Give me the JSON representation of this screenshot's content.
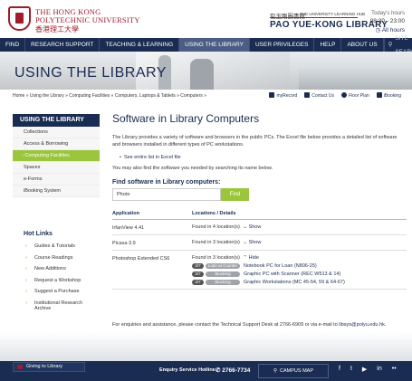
{
  "header": {
    "university_en_line1": "THE HONG KONG",
    "university_en_line2": "POLYTECHNIC UNIVERSITY",
    "university_zh": "香港理工大學",
    "library_zh": "包玉剛圖書館",
    "library_hub": "THE UNIVERSITY LEARNING HUB",
    "library_en": "PAO YUE-KONG LIBRARY",
    "hours_label": "Today's hours",
    "hours_time": "08:30 - 23:00",
    "all_hours": "All hours"
  },
  "nav": {
    "items": [
      {
        "label": "FIND"
      },
      {
        "label": "RESEARCH SUPPORT"
      },
      {
        "label": "TEACHING & LEARNING"
      },
      {
        "label": "USING THE LIBRARY"
      },
      {
        "label": "USER PRIVILEGES"
      },
      {
        "label": "HELP"
      },
      {
        "label": "ABOUT US"
      }
    ],
    "search_placeholder": "SITE SEARCH"
  },
  "banner": {
    "title": "USING THE LIBRARY"
  },
  "breadcrumb": "Home » Using the Library » Computing Facilities » Computers, Laptops & Tablets » Computers »",
  "tools": [
    {
      "label": "myRecord",
      "color": "#1a2c52"
    },
    {
      "label": "Contact Us",
      "color": "#1a2c52"
    },
    {
      "label": "Floor Plan",
      "color": "#1a2c52"
    },
    {
      "label": "iBooking",
      "color": "#1a2c52"
    }
  ],
  "sidebar": {
    "heading": "USING THE LIBRARY",
    "items": [
      {
        "label": "Collections"
      },
      {
        "label": "Access & Borrowing"
      },
      {
        "label": "Computing Facilities"
      },
      {
        "label": "Spaces"
      },
      {
        "label": "e-Forms"
      },
      {
        "label": "iBooking System"
      }
    ],
    "hot_links_title": "Hot Links",
    "hot_links": [
      {
        "label": "Guides & Tutorials"
      },
      {
        "label": "Course Readings"
      },
      {
        "label": "New Additions"
      },
      {
        "label": "Request a Workshop"
      },
      {
        "label": "Suggest a Purchase"
      },
      {
        "label": "Institutional Research Archive"
      }
    ]
  },
  "main": {
    "title": "Software in Library Computers",
    "intro": "The Library provides a variety of software and browsers in the public PCs. The Excel file below provides a detailed list of software and browsers installed in different types of PC workstations.",
    "excel_link": "See entire list in Excel file",
    "tip": "You may also find the software you needed by searching its name below.",
    "find_title": "Find software in Library computers:",
    "search_value": "Photo",
    "find_button": "Find",
    "table_headers": {
      "app": "Application",
      "loc": "Locations / Details"
    },
    "rows": [
      {
        "app": "IrfanView 4.41",
        "found": "Found in 4 location(s)",
        "toggle": "Show"
      },
      {
        "app": "Picasa 3.9",
        "found": "Found in 3 location(s)",
        "toggle": "Show"
      },
      {
        "app": "Photoshop Extended CS6",
        "found": "Found in 3 location(s)",
        "toggle": "Hide"
      }
    ],
    "locations": [
      {
        "count": "3/7",
        "type": "Loan at Counter",
        "name": "Notebook PC for Loan (N806-25)"
      },
      {
        "count": "3/7",
        "type": "iBooking",
        "name": "Graphic PC with Scanner (REC W513 & 14)"
      },
      {
        "count": "3/7",
        "type": "iBooking",
        "name": "Graphic Workstations (MC 45-54, 59 & 64-67)"
      }
    ],
    "enquiry_text": "For enquiries and assistance, please contact the Technical Support Desk at 2766-6909 or via e-mail to",
    "enquiry_email": "libsys@polyu.edu.hk",
    "enquiry_end": "."
  },
  "footer": {
    "giving": "Giving to Library",
    "hotline_label": "Enquiry Service Hotline",
    "phone": "2766-7734",
    "campus_map": "CAMPUS MAP",
    "social": [
      {
        "icon": "facebook-icon",
        "glyph": "f"
      },
      {
        "icon": "twitter-icon",
        "glyph": "t"
      },
      {
        "icon": "youtube-icon",
        "glyph": "▶"
      },
      {
        "icon": "linkedin-icon",
        "glyph": "in"
      },
      {
        "icon": "flickr-icon",
        "glyph": "••"
      }
    ]
  },
  "colors": {
    "navy": "#1a2c52",
    "green": "#9bc53d",
    "maroon": "#a01c2c"
  }
}
